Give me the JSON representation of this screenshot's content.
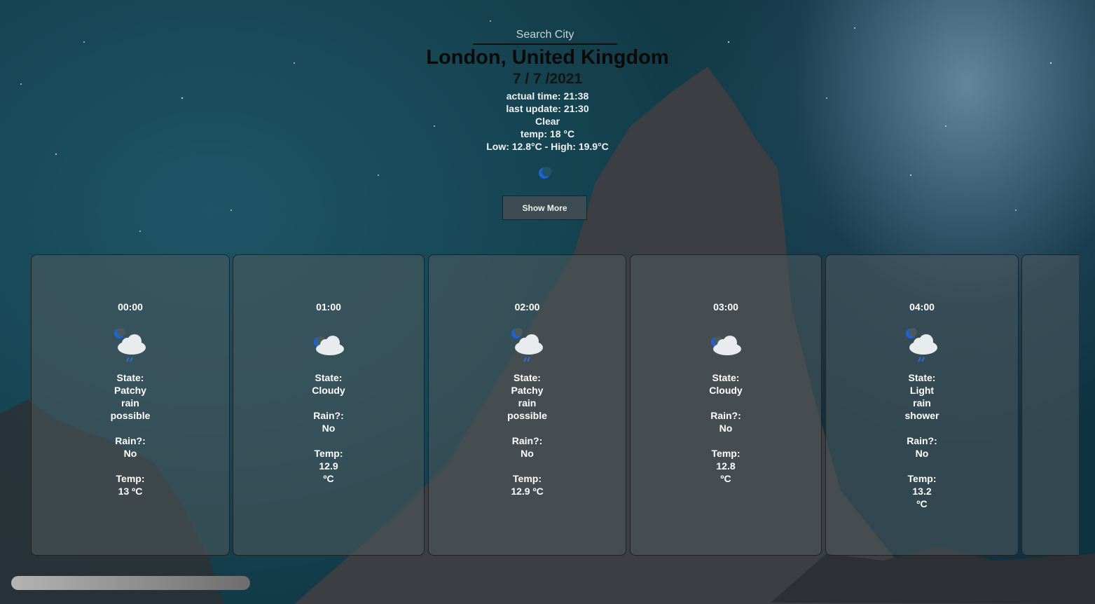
{
  "search": {
    "placeholder": "Search City"
  },
  "location": "London, United Kingdom",
  "date": "7 / 7 /2021",
  "info": {
    "actual_time": "actual time: 21:38",
    "last_update": "last update: 21:30",
    "condition": "Clear",
    "temp": "temp: 18 °C",
    "low_high": "Low: 12.8°C - High: 19.9°C"
  },
  "main_icon": "moon-icon",
  "show_more_label": "Show More",
  "labels": {
    "state": "State:",
    "rain": "Rain?:",
    "temp": "Temp:"
  },
  "hourly": [
    {
      "time": "00:00",
      "icon": "moon-cloud-rain-icon",
      "state": [
        "Patchy",
        "rain",
        "possible"
      ],
      "rain": "No",
      "temp": [
        "13 ºC"
      ]
    },
    {
      "time": "01:00",
      "icon": "moon-cloud-icon",
      "state": [
        "Cloudy"
      ],
      "rain": "No",
      "temp": [
        "12.9",
        "ºC"
      ]
    },
    {
      "time": "02:00",
      "icon": "moon-cloud-rain-icon",
      "state": [
        "Patchy",
        "rain",
        "possible"
      ],
      "rain": "No",
      "temp": [
        "12.9 ºC"
      ]
    },
    {
      "time": "03:00",
      "icon": "moon-cloud-icon",
      "state": [
        "Cloudy"
      ],
      "rain": "No",
      "temp": [
        "12.8",
        "ºC"
      ]
    },
    {
      "time": "04:00",
      "icon": "moon-cloud-rain-icon",
      "state": [
        "Light",
        "rain",
        "shower"
      ],
      "rain": "No",
      "temp": [
        "13.2",
        "ºC"
      ]
    }
  ],
  "colors": {
    "moon": "#1e63d6",
    "cloud": "#e9ecef",
    "rain": "#2e6fd8"
  }
}
